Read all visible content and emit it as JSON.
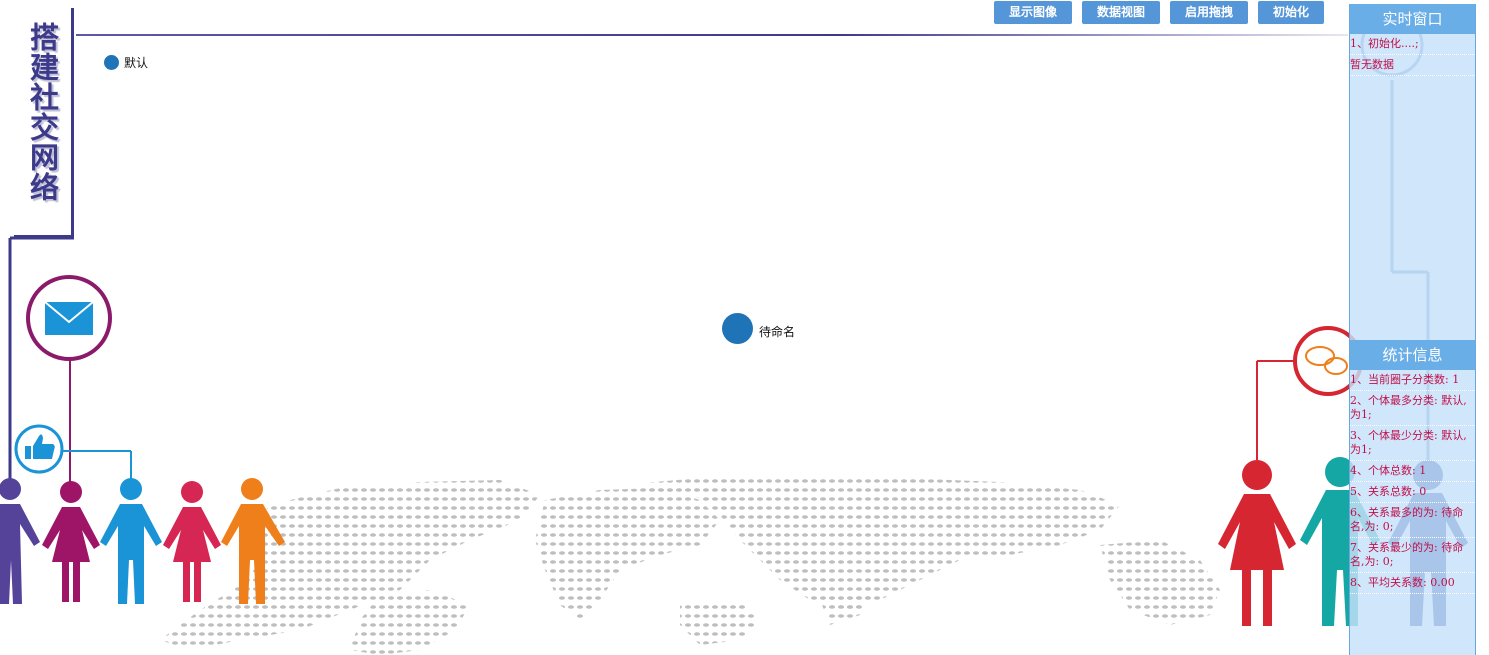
{
  "title": "搭建社交网络",
  "toolbar": {
    "show_image": "显示图像",
    "data_view": "数据视图",
    "enable_drag": "启用拖拽",
    "init": "初始化"
  },
  "legend": {
    "label": "默认",
    "color": "#1f73b7"
  },
  "graph": {
    "node_label": "待命名",
    "node_color": "#1f73b7"
  },
  "realtime_panel": {
    "title": "实时窗口",
    "rows": [
      "1、初始化....;",
      "暂无数据"
    ]
  },
  "stats_panel": {
    "title": "统计信息",
    "rows": [
      "1、当前圈子分类数: 1",
      "2、个体最多分类: 默认,为1;",
      "3、个体最少分类: 默认,为1;",
      "4、个体总数: 1",
      "5、关系总数: 0",
      "6、关系最多的为: 待命名,为: 0;",
      "7、关系最少的为: 待命名,为: 0;",
      "8、平均关系数: 0.00"
    ]
  },
  "colors": {
    "accent": "#3d3a8a",
    "button": "#5596d8",
    "panel_head": "#6aaee8",
    "panel_text": "#c0104a"
  },
  "decor": {
    "icons": [
      "mail-icon",
      "thumbs-up-icon",
      "chat-bubbles-icon",
      "world-map-dots",
      "people-figures"
    ]
  }
}
